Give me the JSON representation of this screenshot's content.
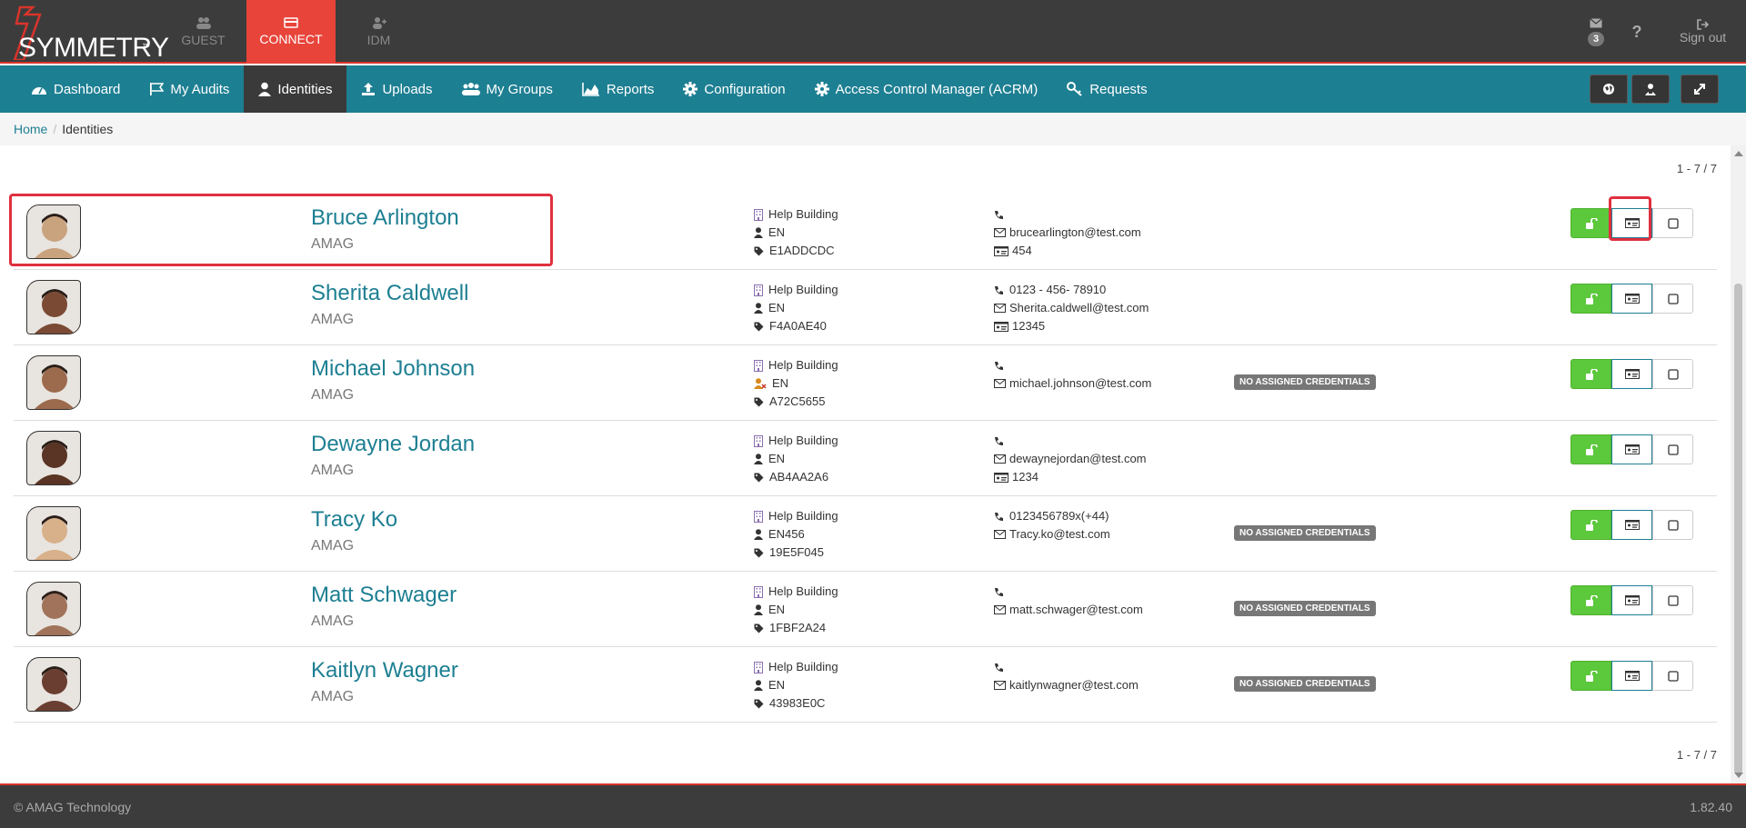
{
  "brand": {
    "name": "SYMMETRY",
    "tm": "™"
  },
  "topnav": [
    {
      "label": "GUEST",
      "icon": "users-icon"
    },
    {
      "label": "CONNECT",
      "icon": "card-icon"
    },
    {
      "label": "IDM",
      "icon": "user-plus-icon"
    }
  ],
  "topright": {
    "messages_count": "3",
    "help": "?",
    "signout": "Sign out"
  },
  "mainnav": [
    {
      "label": "Dashboard",
      "icon": "dashboard-icon"
    },
    {
      "label": "My Audits",
      "icon": "flag-icon"
    },
    {
      "label": "Identities",
      "icon": "user-icon",
      "active": true
    },
    {
      "label": "Uploads",
      "icon": "upload-icon"
    },
    {
      "label": "My Groups",
      "icon": "group-icon"
    },
    {
      "label": "Reports",
      "icon": "chart-icon"
    },
    {
      "label": "Configuration",
      "icon": "gear-icon"
    },
    {
      "label": "Access Control Manager (ACRM)",
      "icon": "gear-icon"
    },
    {
      "label": "Requests",
      "icon": "key-icon"
    }
  ],
  "breadcrumb": {
    "home": "Home",
    "separator": "/",
    "current": "Identities"
  },
  "pager": {
    "text": "1 - 7 / 7"
  },
  "identities": [
    {
      "name": "Bruce Arlington",
      "org": "AMAG",
      "building": "Help Building",
      "lang": "EN",
      "tag": "E1ADDCDC",
      "phone": "",
      "email": "brucearlington@test.com",
      "card": "454",
      "badge": "",
      "avatar_bg": "#c9a27e"
    },
    {
      "name": "Sherita Caldwell",
      "org": "AMAG",
      "building": "Help Building",
      "lang": "EN",
      "tag": "F4A0AE40",
      "phone": "0123 - 456- 78910",
      "email": "Sherita.caldwell@test.com",
      "card": "12345",
      "badge": "",
      "avatar_bg": "#7a4a34"
    },
    {
      "name": "Michael Johnson",
      "org": "AMAG",
      "building": "Help Building",
      "lang": "EN",
      "tag": "A72C5655",
      "phone": "",
      "email": "michael.johnson@test.com",
      "card": "",
      "badge": "NO ASSIGNED CREDENTIALS",
      "avatar_bg": "#9c6a4c",
      "lang_warning": true
    },
    {
      "name": "Dewayne Jordan",
      "org": "AMAG",
      "building": "Help Building",
      "lang": "EN",
      "tag": "AB4AA2A6",
      "phone": "",
      "email": "dewaynejordan@test.com",
      "card": "1234",
      "badge": "",
      "avatar_bg": "#5a3424"
    },
    {
      "name": "Tracy Ko",
      "org": "AMAG",
      "building": "Help Building",
      "lang": "EN456",
      "tag": "19E5F045",
      "phone": "0123456789x(+44)",
      "email": "Tracy.ko@test.com",
      "card": "",
      "badge": "NO ASSIGNED CREDENTIALS",
      "avatar_bg": "#d8b089"
    },
    {
      "name": "Matt Schwager",
      "org": "AMAG",
      "building": "Help Building",
      "lang": "EN",
      "tag": "1FBF2A24",
      "phone": "",
      "email": "matt.schwager@test.com",
      "card": "",
      "badge": "NO ASSIGNED CREDENTIALS",
      "avatar_bg": "#a0735a"
    },
    {
      "name": "Kaitlyn Wagner",
      "org": "AMAG",
      "building": "Help Building",
      "lang": "EN",
      "tag": "43983E0C",
      "phone": "",
      "email": "kaitlynwagner@test.com",
      "card": "",
      "badge": "NO ASSIGNED CREDENTIALS",
      "avatar_bg": "#6b3e32"
    }
  ],
  "footer": {
    "copyright": "© AMAG Technology",
    "version": "1.82.40"
  },
  "colors": {
    "accent": "#1d7f92",
    "brand_red": "#e8443a",
    "green": "#5cc83c",
    "highlight": "#e0303e"
  }
}
